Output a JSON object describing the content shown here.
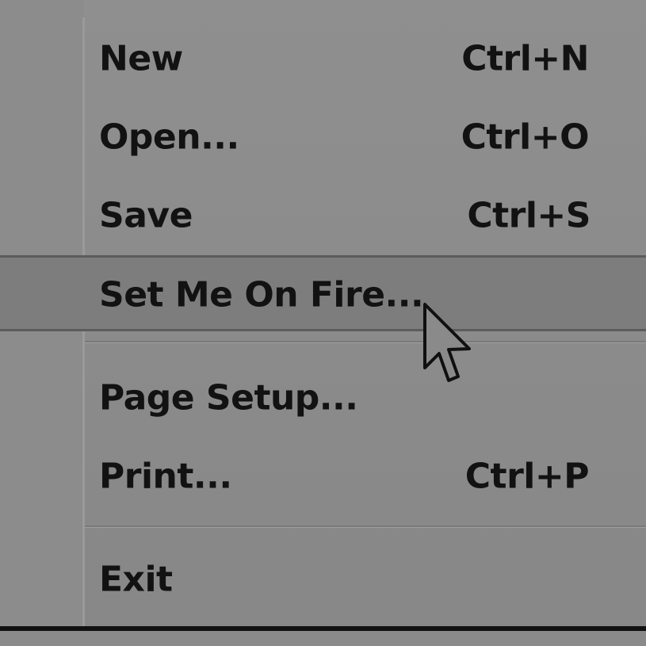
{
  "menu": {
    "items": [
      {
        "label": "New",
        "shortcut": "Ctrl+N"
      },
      {
        "label": "Open...",
        "shortcut": "Ctrl+O"
      },
      {
        "label": "Save",
        "shortcut": "Ctrl+S"
      },
      {
        "label": "Set Me On Fire...",
        "shortcut": "",
        "highlighted": true
      },
      {
        "label": "Page Setup...",
        "shortcut": ""
      },
      {
        "label": "Print...",
        "shortcut": "Ctrl+P"
      },
      {
        "label": "Exit",
        "shortcut": ""
      }
    ]
  },
  "cursor": {
    "icon": "arrow-pointer-icon"
  },
  "colors": {
    "menu_bg": "#8e8e8e",
    "highlight_bg": "#7d7d7d",
    "text": "#121212"
  }
}
